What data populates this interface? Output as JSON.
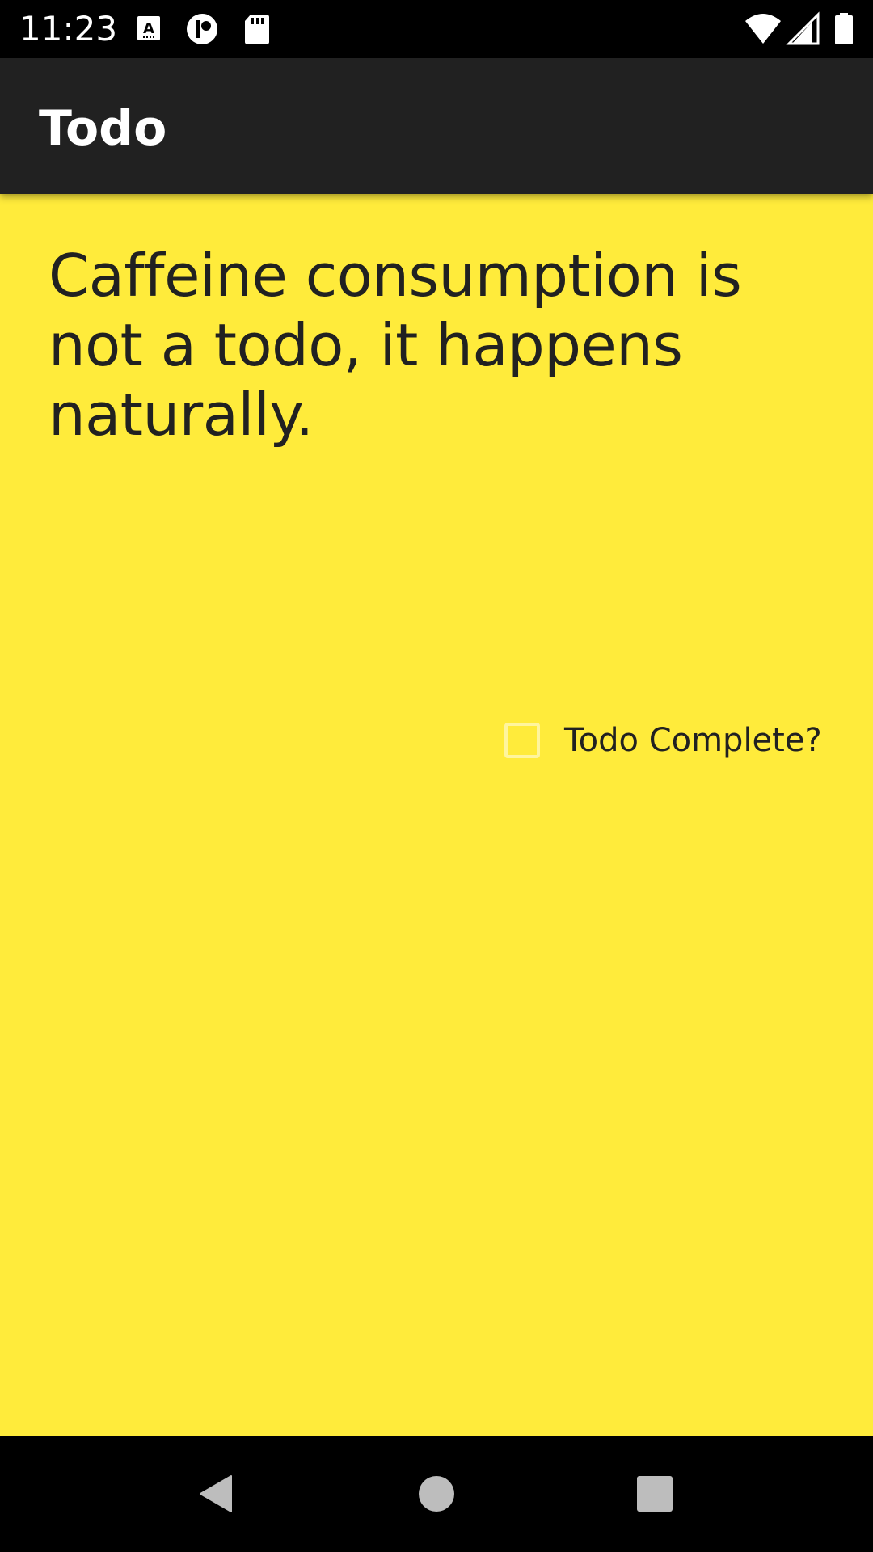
{
  "status_bar": {
    "time": "11:23",
    "icons": [
      "keyboard-a-icon",
      "circle-app-icon",
      "sd-card-icon",
      "wifi-icon",
      "cell-signal-icon",
      "battery-icon"
    ]
  },
  "app_bar": {
    "title": "Todo"
  },
  "todo": {
    "text": "Caffeine consumption is not a todo, it happens naturally.",
    "complete_label": "Todo Complete?",
    "complete_checked": false
  },
  "nav_bar": {
    "buttons": [
      "back-icon",
      "home-icon",
      "recents-icon"
    ]
  },
  "colors": {
    "status_bar": "#000000",
    "app_bar": "#212121",
    "content_background": "#FFEB3B",
    "text": "#212121",
    "checkbox_border": "#FFF59D",
    "nav_bar": "#000000"
  }
}
